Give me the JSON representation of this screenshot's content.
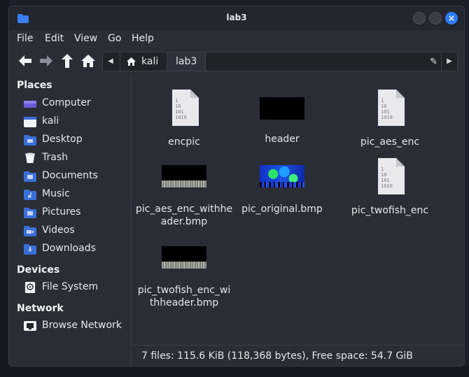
{
  "window": {
    "title": "lab3"
  },
  "menu": [
    "File",
    "Edit",
    "View",
    "Go",
    "Help"
  ],
  "path": {
    "crumbs": [
      "kali",
      "lab3"
    ]
  },
  "sidebar": {
    "places_heading": "Places",
    "places": [
      {
        "label": "Computer",
        "icon": "computer-icon"
      },
      {
        "label": "kali",
        "icon": "home-folder-icon"
      },
      {
        "label": "Desktop",
        "icon": "desktop-folder-icon"
      },
      {
        "label": "Trash",
        "icon": "trash-icon"
      },
      {
        "label": "Documents",
        "icon": "documents-folder-icon"
      },
      {
        "label": "Music",
        "icon": "music-folder-icon"
      },
      {
        "label": "Pictures",
        "icon": "pictures-folder-icon"
      },
      {
        "label": "Videos",
        "icon": "videos-folder-icon"
      },
      {
        "label": "Downloads",
        "icon": "downloads-folder-icon"
      }
    ],
    "devices_heading": "Devices",
    "devices": [
      {
        "label": "File System",
        "icon": "disk-icon"
      }
    ],
    "network_heading": "Network",
    "network": [
      {
        "label": "Browse Network",
        "icon": "network-icon"
      }
    ]
  },
  "files": [
    {
      "name": "encpic",
      "icon": "binary-file-icon"
    },
    {
      "name": "header",
      "icon": "image-thumbnail"
    },
    {
      "name": "pic_aes_enc",
      "icon": "binary-file-icon"
    },
    {
      "name": "pic_aes_enc_withheader.bmp",
      "icon": "image-thumbnail"
    },
    {
      "name": "pic_original.bmp",
      "icon": "image-thumbnail"
    },
    {
      "name": "pic_twofish_enc",
      "icon": "binary-file-icon"
    },
    {
      "name": "pic_twofish_enc_withheader.bmp",
      "icon": "image-thumbnail"
    }
  ],
  "file_icon_text": [
    "1",
    "10",
    "101",
    "1010"
  ],
  "status": "7 files: 115.6 KiB (118,368 bytes), Free space: 54.7 GiB",
  "colors": {
    "accent": "#2f7bf5",
    "background": "#2a2d36",
    "folder": "#3b6fd8"
  }
}
